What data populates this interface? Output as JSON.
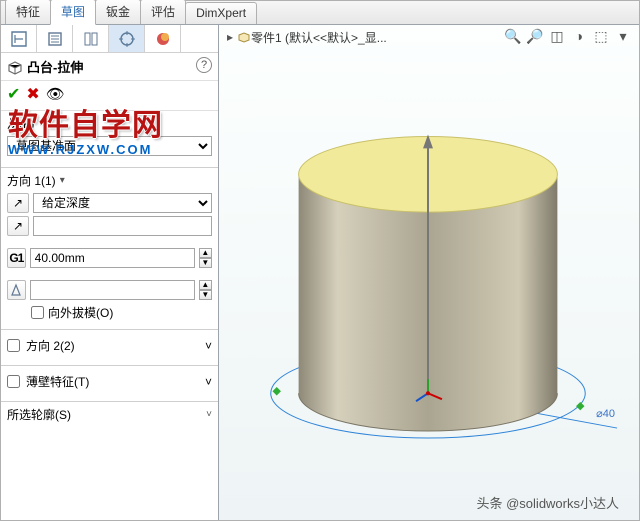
{
  "tabs": {
    "items": [
      "特征",
      "草图",
      "钣金",
      "评估",
      "DimXpert"
    ],
    "active_index": 1
  },
  "feature": {
    "title": "凸台-拉伸",
    "from_label": "从(F)",
    "from_value": "草图基准面",
    "direction1": {
      "label": "方向 1(1)",
      "end_condition": "给定深度",
      "blank_value": "",
      "depth_value": "40.00mm",
      "taper_value": "",
      "draft_outward_label": "向外拔模(O)"
    },
    "direction2_label": "方向 2(2)",
    "thin_feature_label": "薄壁特征(T)",
    "selected_contours_label": "所选轮廓(S)"
  },
  "breadcrumb": {
    "text": "零件1 (默认<<默认>_显..."
  },
  "dim_label": "⌀40",
  "watermark": {
    "main": "软件自学网",
    "sub": "WWW.RJZXW.COM"
  },
  "credit": "头条 @solidworks小达人"
}
